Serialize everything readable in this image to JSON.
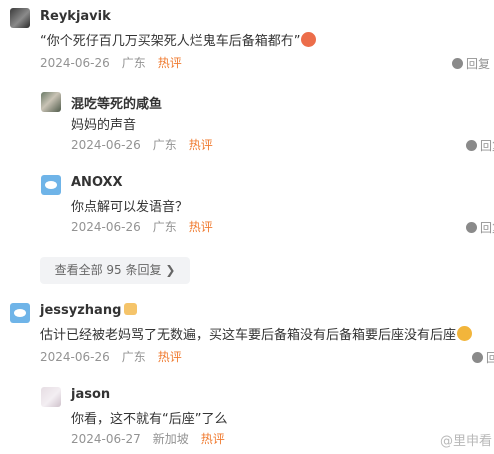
{
  "comments": [
    {
      "user": "Reykjavik",
      "text": "“你个死仔百几万买架死人烂鬼车后备箱都冇”",
      "date": "2024-06-26",
      "location": "广东",
      "tag": "热评",
      "reply_label": "回复"
    },
    {
      "user": "混吃等死的咸鱼",
      "text": "妈妈的声音",
      "date": "2024-06-26",
      "location": "广东",
      "tag": "热评",
      "reply_label": "回复"
    },
    {
      "user": "ANOXX",
      "text": "你点解可以发语音？",
      "date": "2024-06-26",
      "location": "广东",
      "tag": "热评",
      "reply_label": "回复"
    },
    {
      "user": "jessyzhang",
      "text": "估计已经被老妈骂了无数遍，买这车要后备箱没有后备箱要后座没有后座",
      "date": "2024-06-26",
      "location": "广东",
      "tag": "热评",
      "reply_label": "回复"
    },
    {
      "user": "jason",
      "text": "你看，这不就有“后座”了么",
      "date": "2024-06-27",
      "location": "新加坡",
      "tag": "热评",
      "reply_label": "回复"
    }
  ],
  "view_all_replies": "查看全部 95 条回复 ❯",
  "watermark": "@里申看"
}
